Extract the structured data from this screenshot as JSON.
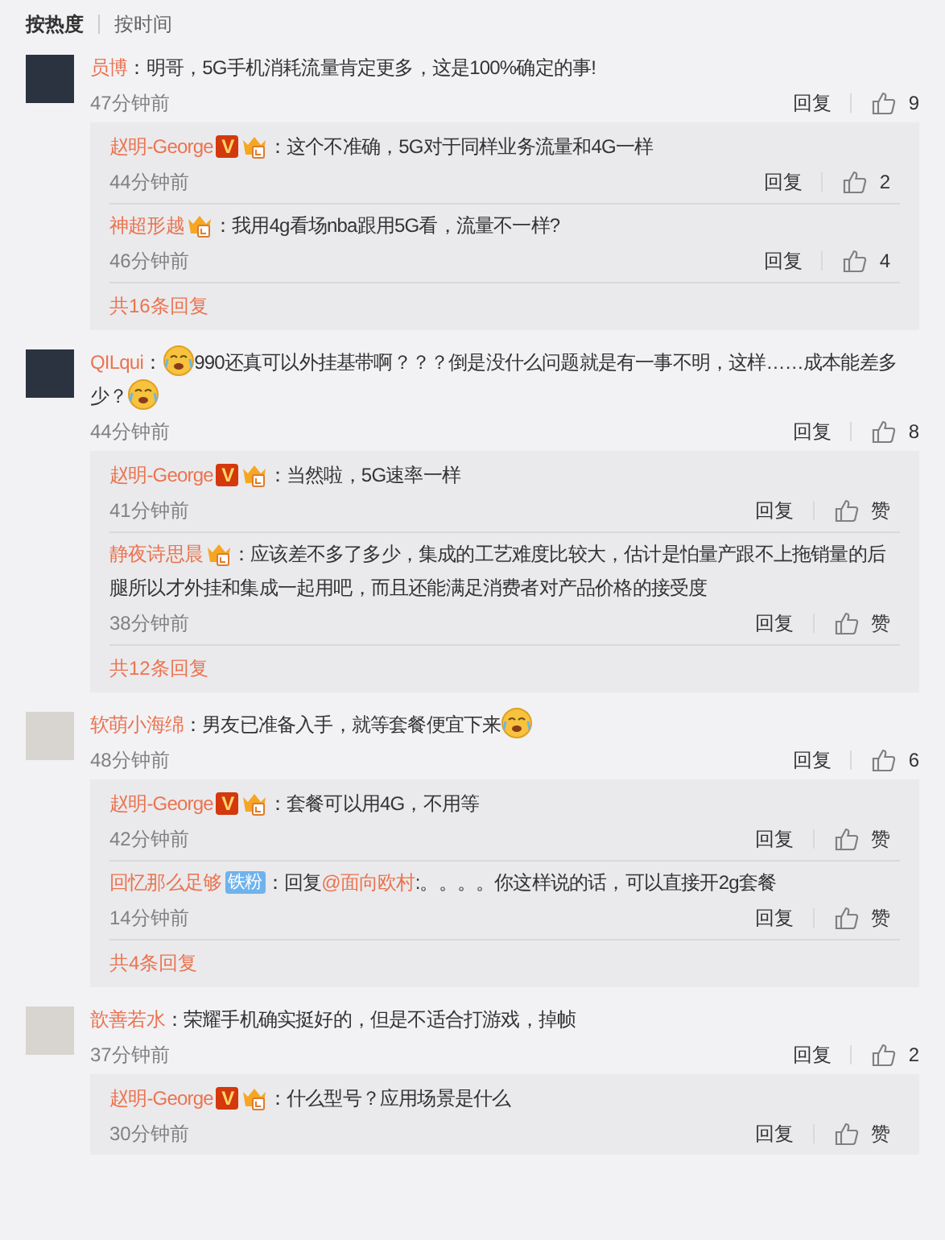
{
  "sort_tabs": [
    {
      "label": "按热度",
      "selected": true
    },
    {
      "label": "按时间",
      "selected": false
    }
  ],
  "comments": [
    {
      "user": "员博",
      "content": [
        {
          "kind": "text",
          "text": "：明哥，5G手机消耗流量肯定更多，这是100%确定的事!"
        }
      ],
      "time": "47分钟前",
      "reply_label": "回复",
      "likes": "9",
      "replies": [
        {
          "user": "赵明-George",
          "v_badge": "V",
          "crown": true,
          "content": [
            {
              "kind": "text",
              "text": "：这个不准确，5G对于同样业务流量和4G一样"
            }
          ],
          "time": "44分钟前",
          "reply_label": "回复",
          "likes": "2"
        },
        {
          "user": "神超形越",
          "crown": true,
          "content": [
            {
              "kind": "text",
              "text": "：我用4g看场nba跟用5G看，流量不一样?"
            }
          ],
          "time": "46分钟前",
          "reply_label": "回复",
          "likes": "4"
        }
      ],
      "more": "共16条回复"
    },
    {
      "user": "QILqui",
      "content": [
        {
          "kind": "text",
          "text": "："
        },
        {
          "kind": "emoji"
        },
        {
          "kind": "text",
          "text": "990还真可以外挂基带啊？？？倒是没什么问题就是有一事不明，这样……成本能差多少？"
        },
        {
          "kind": "emoji"
        }
      ],
      "time": "44分钟前",
      "reply_label": "回复",
      "likes": "8",
      "replies": [
        {
          "user": "赵明-George",
          "v_badge": "V",
          "crown": true,
          "content": [
            {
              "kind": "text",
              "text": "：当然啦，5G速率一样"
            }
          ],
          "time": "41分钟前",
          "reply_label": "回复",
          "likes": "赞"
        },
        {
          "user": "静夜诗思晨",
          "crown": true,
          "content": [
            {
              "kind": "text",
              "text": "：应该差不多了多少，集成的工艺难度比较大，估计是怕量产跟不上拖销量的后腿所以才外挂和集成一起用吧，而且还能满足消费者对产品价格的接受度"
            }
          ],
          "time": "38分钟前",
          "reply_label": "回复",
          "likes": "赞"
        }
      ],
      "more": "共12条回复"
    },
    {
      "user": "软萌小海绵",
      "content": [
        {
          "kind": "text",
          "text": "：男友已准备入手，就等套餐便宜下来"
        },
        {
          "kind": "emoji"
        }
      ],
      "time": "48分钟前",
      "reply_label": "回复",
      "likes": "6",
      "replies": [
        {
          "user": "赵明-George",
          "v_badge": "V",
          "crown": true,
          "content": [
            {
              "kind": "text",
              "text": "：套餐可以用4G，不用等"
            }
          ],
          "time": "42分钟前",
          "reply_label": "回复",
          "likes": "赞"
        },
        {
          "user": "回忆那么足够",
          "fan_badge": "铁粉",
          "content": [
            {
              "kind": "text",
              "text": "：回复"
            },
            {
              "kind": "mention",
              "text": "@面向欧村"
            },
            {
              "kind": "text",
              "text": ":。。。。你这样说的话，可以直接开2g套餐"
            }
          ],
          "time": "14分钟前",
          "reply_label": "回复",
          "likes": "赞"
        }
      ],
      "more": "共4条回复"
    },
    {
      "user": "歆善若水",
      "content": [
        {
          "kind": "text",
          "text": "：荣耀手机确实挺好的，但是不适合打游戏，掉帧"
        }
      ],
      "time": "37分钟前",
      "reply_label": "回复",
      "likes": "2",
      "replies": [
        {
          "user": "赵明-George",
          "v_badge": "V",
          "crown": true,
          "content": [
            {
              "kind": "text",
              "text": "：什么型号？应用场景是什么"
            }
          ],
          "time": "30分钟前",
          "reply_label": "回复",
          "likes": "赞"
        }
      ]
    }
  ]
}
